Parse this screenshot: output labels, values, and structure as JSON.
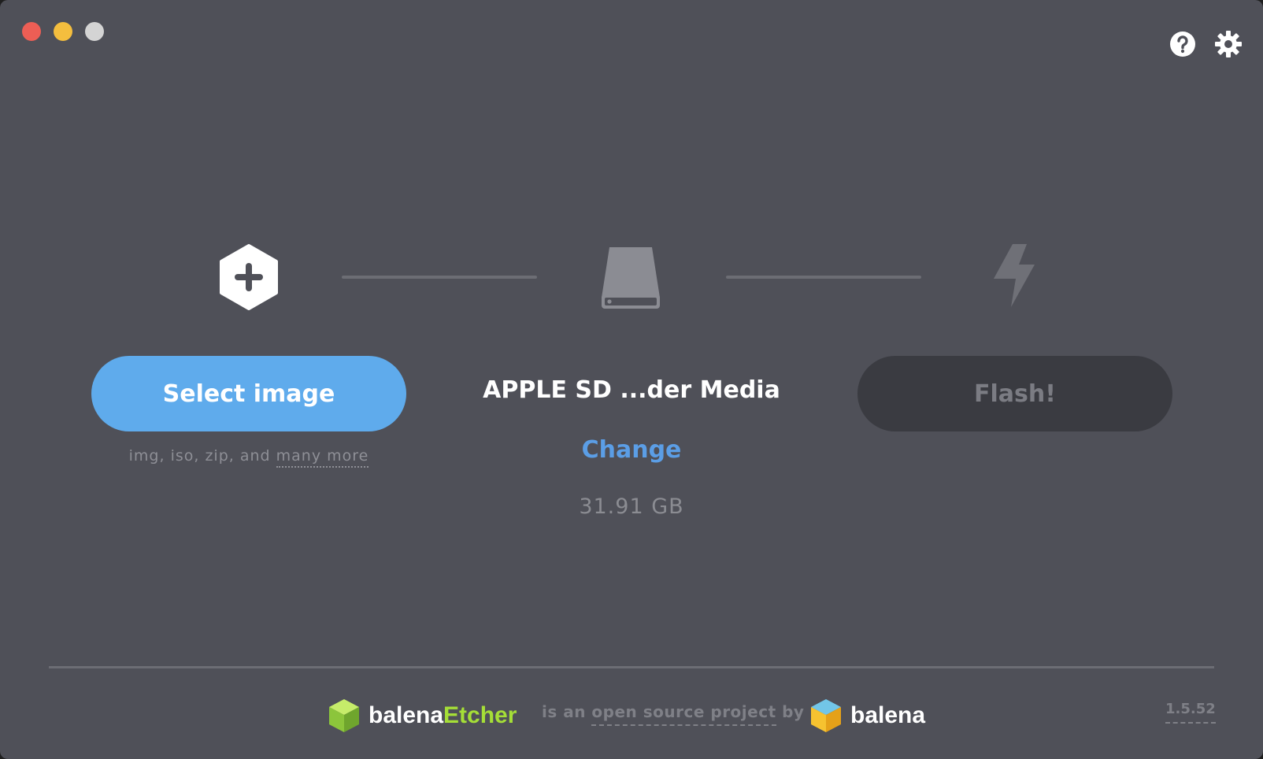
{
  "window": {
    "controls": [
      "close",
      "minimize",
      "maximize"
    ],
    "top_icons": [
      "help-icon",
      "gear-icon"
    ]
  },
  "steps": {
    "image": {
      "icon": "plus-hexagon-icon",
      "button_label": "Select image",
      "hint_prefix": "img, iso, zip, and ",
      "hint_link": "many more"
    },
    "drive": {
      "icon": "drive-icon",
      "name": "APPLE SD ...der Media",
      "change_label": "Change",
      "size": "31.91 GB"
    },
    "flash": {
      "icon": "lightning-icon",
      "button_label": "Flash!"
    }
  },
  "footer": {
    "etcher_brand_a": "balena",
    "etcher_brand_b": "Etcher",
    "oss_prefix": "is an ",
    "oss_link": "open source project",
    "oss_suffix": " by",
    "balena_brand": "balena",
    "version": "1.5.52"
  },
  "colors": {
    "background": "#4f5058",
    "select_button": "#5fabec",
    "flash_button_disabled": "#3a3b41",
    "link": "#5b9ee6",
    "etcher_green": "#a5de37"
  }
}
